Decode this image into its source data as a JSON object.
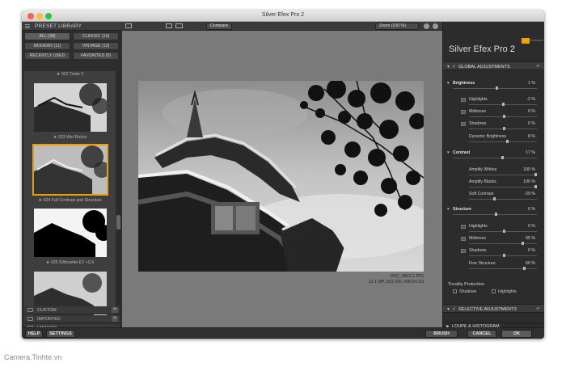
{
  "window": {
    "title": "Silver Efex Pro 2"
  },
  "left_panel": {
    "header": "PRESET LIBRARY",
    "filters": [
      {
        "label": "ALL (38)",
        "active": true
      },
      {
        "label": "CLASSIC (15)",
        "active": false
      },
      {
        "label": "MODERN (11)",
        "active": false
      },
      {
        "label": "VINTAGE (12)",
        "active": false
      },
      {
        "label": "RECENTLY USED",
        "active": false
      },
      {
        "label": "FAVORITES (0)",
        "active": false
      }
    ],
    "presets": [
      {
        "label": "★ 022 Triste 2"
      },
      {
        "label": "★ 023 Wet Rocks"
      },
      {
        "label": "★ 024 Full Contrast and Structure",
        "selected": true
      },
      {
        "label": "★ 025 Silhouette EV +0.5"
      }
    ],
    "categories": [
      {
        "label": "CUSTOM"
      },
      {
        "label": "IMPORTED"
      },
      {
        "label": "HISTORY"
      }
    ]
  },
  "toolbar": {
    "compare_label": "Compare",
    "zoom_label": "Zoom (100 %)"
  },
  "canvas": {
    "filename": "DSC_4853 2.JPG",
    "meta": "12.1 MP, ISO 200, NIKON D3"
  },
  "right_panel": {
    "app_name": "Silver Efex Pro",
    "app_version": "2",
    "brand_sub": "Collection",
    "global_header": "GLOBAL ADJUSTMENTS",
    "brightness": {
      "label": "Brightness",
      "value": "1 %",
      "subs": [
        {
          "label": "Highlights",
          "value": "-2 %"
        },
        {
          "label": "Midtones",
          "value": "0 %"
        },
        {
          "label": "Shadows",
          "value": "0 %"
        }
      ],
      "dynamic": {
        "label": "Dynamic Brightness",
        "value": "8 %"
      }
    },
    "contrast": {
      "label": "Contrast",
      "value": "17 %",
      "subs": [
        {
          "label": "Amplify Whites",
          "value": "100 %"
        },
        {
          "label": "Amplify Blacks",
          "value": "100 %"
        },
        {
          "label": "Soft Contrast",
          "value": "-29 %"
        }
      ]
    },
    "structure": {
      "label": "Structure",
      "value": "0 %",
      "subs": [
        {
          "label": "Highlights",
          "value": "0 %"
        },
        {
          "label": "Midtones",
          "value": "55 %"
        },
        {
          "label": "Shadows",
          "value": "0 %"
        },
        {
          "label": "Fine Structure",
          "value": "60 %"
        }
      ]
    },
    "tonality": {
      "label": "Tonality Protection",
      "shadows": "Shadows",
      "highlights": "Highlights"
    },
    "selective_header": "SELECTIVE ADJUSTMENTS",
    "loupe_header": "LOUPE & HISTOGRAM"
  },
  "bottom": {
    "help": "HELP",
    "settings": "SETTINGS",
    "brush": "BRUSH",
    "cancel": "CANCEL",
    "ok": "OK"
  },
  "watermark": "Camera.Tinhte.vn"
}
